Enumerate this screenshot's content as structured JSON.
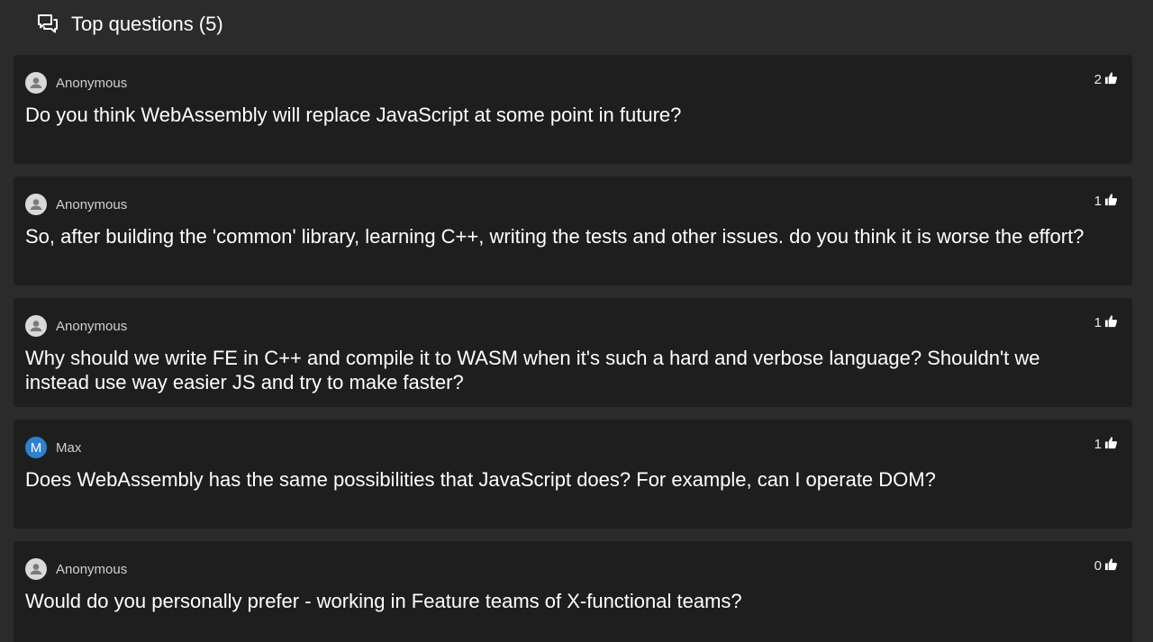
{
  "header": {
    "title": "Top questions",
    "count": "(5)"
  },
  "questions": [
    {
      "author": "Anonymous",
      "avatar": "anonymous",
      "votes": "2",
      "text": "Do you think WebAssembly will replace JavaScript at some point in future?"
    },
    {
      "author": "Anonymous",
      "avatar": "anonymous",
      "votes": "1",
      "text": "So, after building the 'common' library, learning C++, writing the tests and other issues. do you think it is worse the effort?"
    },
    {
      "author": "Anonymous",
      "avatar": "anonymous",
      "votes": "1",
      "text": "Why should we write FE in C++ and compile it to WASM when it's such a hard and verbose language? Shouldn't we instead use way easier JS and try to make faster?"
    },
    {
      "author": "Max",
      "avatar": "M",
      "votes": "1",
      "text": "Does WebAssembly has the same possibilities that JavaScript does? For example, can I operate DOM?"
    },
    {
      "author": "Anonymous",
      "avatar": "anonymous",
      "votes": "0",
      "text": "Would do you personally prefer - working in Feature teams of X-functional teams?"
    }
  ],
  "colors": {
    "background": "#2b2b2b",
    "card": "#1e1e1e",
    "avatar_letter_bg": "#2f80d1"
  },
  "icons": {
    "header": "chat-bubbles-icon",
    "vote": "thumbs-up-icon",
    "anonymous_avatar": "person-icon"
  }
}
